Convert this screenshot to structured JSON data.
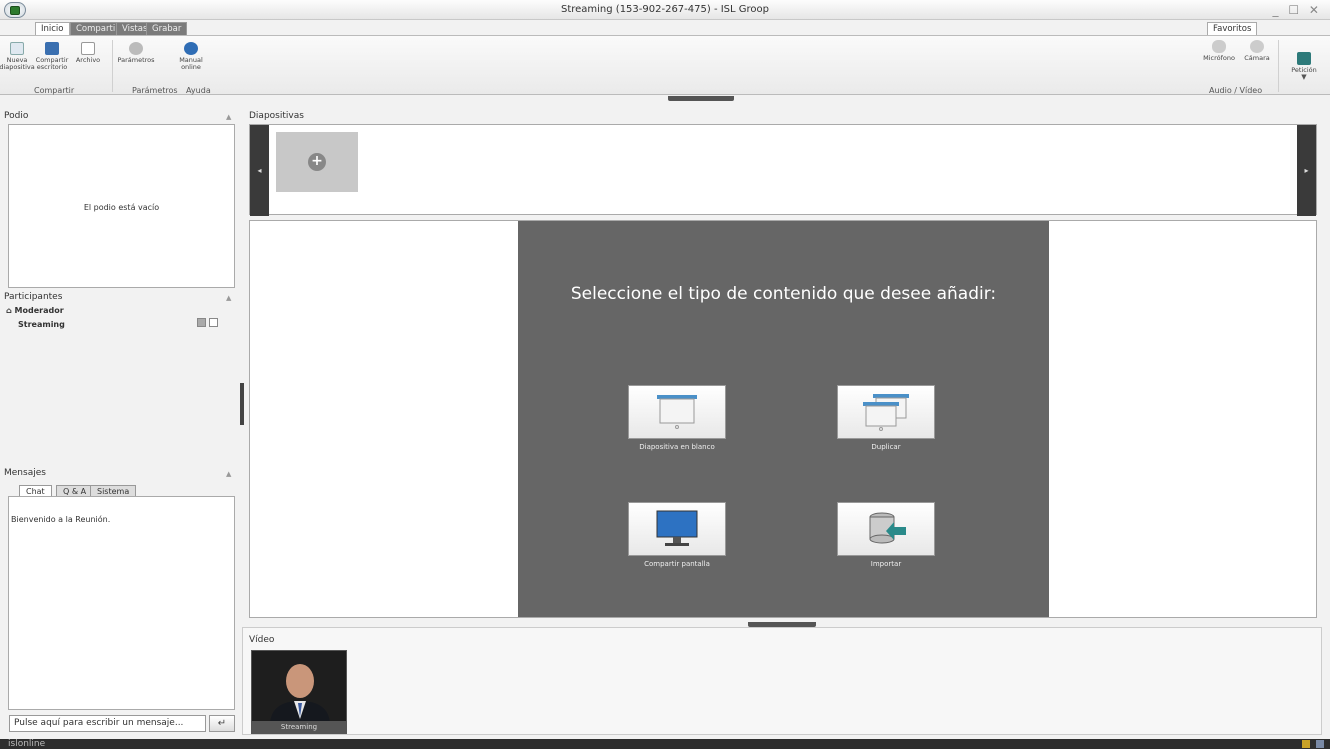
{
  "window": {
    "title": "Streaming (153-902-267-475) - ISL Groop",
    "controls": "_ ☐ ✕"
  },
  "ribbon": {
    "tabs": [
      "Inicio",
      "Compartir",
      "Vistas",
      "Grabar"
    ],
    "right_tab": "Favoritos",
    "buttons": {
      "new_slide": "Nueva diapositiva",
      "share_desktop": "Compartir escritorio",
      "file": "Archivo",
      "parameters": "Parámetros",
      "manual": "Manual online",
      "microphone": "Micrófono",
      "camera": "Cámara",
      "request": "Petición"
    },
    "groups": {
      "share": "Compartir",
      "params": "Parámetros",
      "help": "Ayuda",
      "av": "Audio / Vídeo"
    }
  },
  "podium": {
    "title": "Podio",
    "empty_text": "El podio está vacío"
  },
  "participants": {
    "title": "Participantes",
    "role": "Moderador",
    "user": "Streaming"
  },
  "messages": {
    "title": "Mensajes",
    "tabs": [
      "Chat",
      "Q & A",
      "Sistema"
    ],
    "welcome": "Bienvenido a la Reunión.",
    "placeholder": "Pulse aquí para escribir un mensaje...",
    "send_icon": "↵"
  },
  "slides": {
    "title": "Diapositivas"
  },
  "stage": {
    "prompt": "Seleccione el tipo de contenido que desee añadir:",
    "options": {
      "blank": "Diapositiva en blanco",
      "duplicate": "Duplicar",
      "share_screen": "Compartir pantalla",
      "import": "Importar"
    }
  },
  "video": {
    "title": "Vídeo",
    "participant": "Streaming"
  },
  "status": {
    "brand": "islonline"
  },
  "colors": {
    "accent_blue": "#4a90c8",
    "dark": "#3a3a3a",
    "stage": "#666666"
  }
}
